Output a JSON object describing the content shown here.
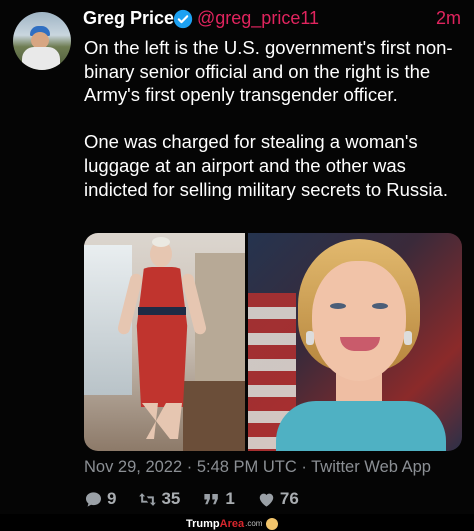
{
  "author": {
    "name": "Greg Price",
    "handle": "@greg_price11",
    "time_ago": "2m",
    "verified": true
  },
  "tweet": {
    "paragraphs": [
      "On the left is the U.S. government's first non-binary senior official and on the right is the Army's first openly transgender officer.",
      "One was charged for stealing a woman's luggage at an airport and the other was indicted for selling military secrets to Russia."
    ],
    "images": [
      "person-red-dress-office-photo",
      "person-blonde-teal-top-photo"
    ]
  },
  "meta": {
    "timestamp": "Nov 29, 2022 · 5:48 PM UTC · Twitter Web App"
  },
  "actions": {
    "replies": "9",
    "retweets": "35",
    "quotes": "1",
    "likes": "76"
  },
  "watermark": {
    "part1": "Trump",
    "part2": "Area",
    "part3": ".com"
  },
  "colors": {
    "background": "#000000",
    "accent": "#e0245e",
    "verified": "#1da1f2",
    "muted": "#8b8f94"
  }
}
